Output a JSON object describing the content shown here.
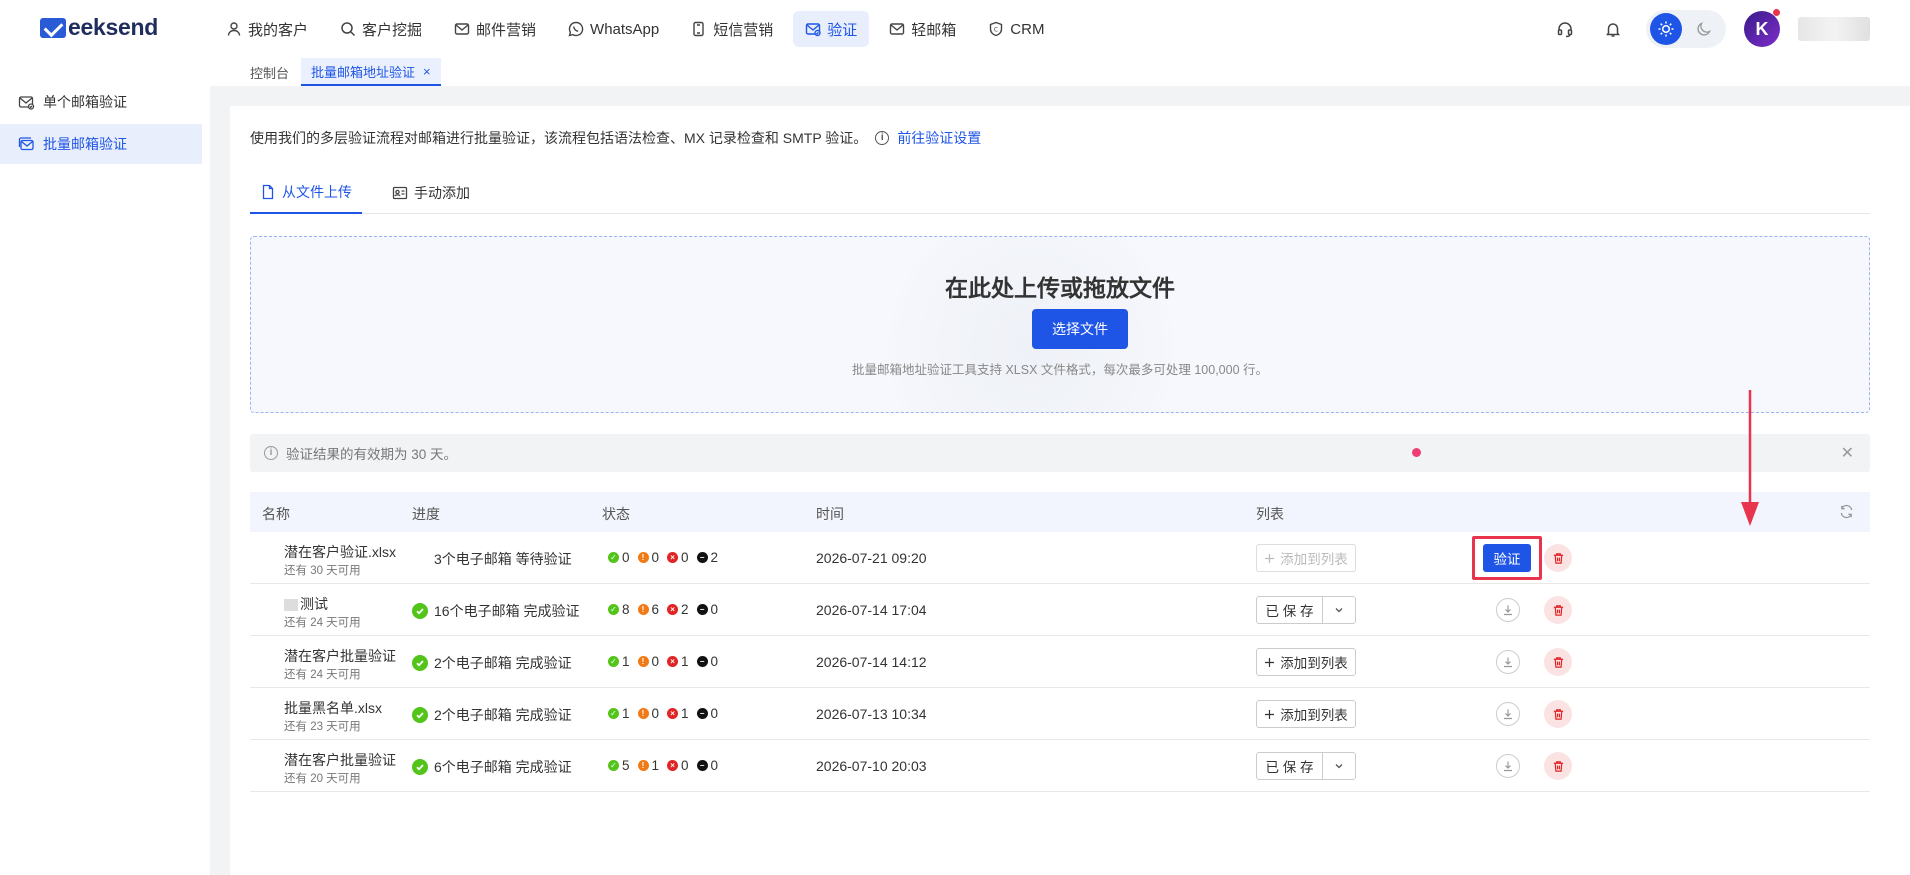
{
  "brand": {
    "logo_text": "eeksend"
  },
  "nav": [
    {
      "label": "我的客户",
      "icon": "user-icon",
      "active": false
    },
    {
      "label": "客户挖掘",
      "icon": "search-icon",
      "active": false
    },
    {
      "label": "邮件营销",
      "icon": "mail-icon",
      "active": false
    },
    {
      "label": "WhatsApp",
      "icon": "whatsapp-icon",
      "active": false
    },
    {
      "label": "短信营销",
      "icon": "sms-icon",
      "active": false
    },
    {
      "label": "验证",
      "icon": "verify-mail-icon",
      "active": true
    },
    {
      "label": "轻邮箱",
      "icon": "light-mail-icon",
      "active": false
    },
    {
      "label": "CRM",
      "icon": "crm-icon",
      "active": false
    }
  ],
  "header": {
    "avatar_letter": "K"
  },
  "sidebar": {
    "items": [
      {
        "label": "单个邮箱验证",
        "active": false
      },
      {
        "label": "批量邮箱验证",
        "active": true
      }
    ]
  },
  "page_tabs": [
    {
      "label": "控制台",
      "active": false
    },
    {
      "label": "批量邮箱地址验证",
      "active": true,
      "close": "×"
    }
  ],
  "intro": {
    "text": "使用我们的多层验证流程对邮箱进行批量验证，该流程包括语法检查、MX 记录检查和 SMTP 验证。",
    "link": "前往验证设置",
    "info_glyph": "i"
  },
  "upload_tabs": [
    {
      "label": "从文件上传",
      "active": true
    },
    {
      "label": "手动添加",
      "active": false
    }
  ],
  "dropzone": {
    "title": "在此处上传或拖放文件",
    "button": "选择文件",
    "desc": "批量邮箱地址验证工具支持 XLSX 文件格式，每次最多可处理 100,000 行。"
  },
  "notice": {
    "text": "验证结果的有效期为 30 天。",
    "close": "✕",
    "info_glyph": "i"
  },
  "table": {
    "headers": {
      "name": "名称",
      "progress": "进度",
      "status": "状态",
      "time": "时间",
      "list": "列表"
    },
    "rows": [
      {
        "name": "潜在客户验证.xlsx",
        "sub": "还有 30 天可用",
        "progress": "3个电子邮箱 等待验证",
        "done": false,
        "s_ok": "0",
        "s_warn": "0",
        "s_bad": "0",
        "s_unk": "2",
        "time": "2026-07-21 09:20",
        "list_type": "add",
        "list_label": "添加到列表",
        "list_disabled": true,
        "verify_label": "验证"
      },
      {
        "name": "测试",
        "sub": "还有 24 天可用",
        "progress": "16个电子邮箱 完成验证",
        "done": true,
        "s_ok": "8",
        "s_warn": "6",
        "s_bad": "2",
        "s_unk": "0",
        "time": "2026-07-14 17:04",
        "list_type": "saved",
        "list_label": "已 保 存"
      },
      {
        "name": "潜在客户批量验证",
        "sub": "还有 24 天可用",
        "progress": "2个电子邮箱 完成验证",
        "done": true,
        "s_ok": "1",
        "s_warn": "0",
        "s_bad": "1",
        "s_unk": "0",
        "time": "2026-07-14 14:12",
        "list_type": "add",
        "list_label": "添加到列表"
      },
      {
        "name": "批量黑名单.xlsx",
        "sub": "还有 23 天可用",
        "progress": "2个电子邮箱 完成验证",
        "done": true,
        "s_ok": "1",
        "s_warn": "0",
        "s_bad": "1",
        "s_unk": "0",
        "time": "2026-07-13 10:34",
        "list_type": "add",
        "list_label": "添加到列表"
      },
      {
        "name": "潜在客户批量验证",
        "sub": "还有 20 天可用",
        "progress": "6个电子邮箱 完成验证",
        "done": true,
        "s_ok": "5",
        "s_warn": "1",
        "s_bad": "0",
        "s_unk": "0",
        "time": "2026-07-10 20:03",
        "list_type": "saved",
        "list_label": "已 保 存"
      }
    ]
  },
  "colors": {
    "accent": "#1f55e6",
    "ok": "#52c41a",
    "warn": "#f07b16",
    "bad": "#e02424",
    "unknown": "#111111",
    "highlight": "#e8344c"
  }
}
